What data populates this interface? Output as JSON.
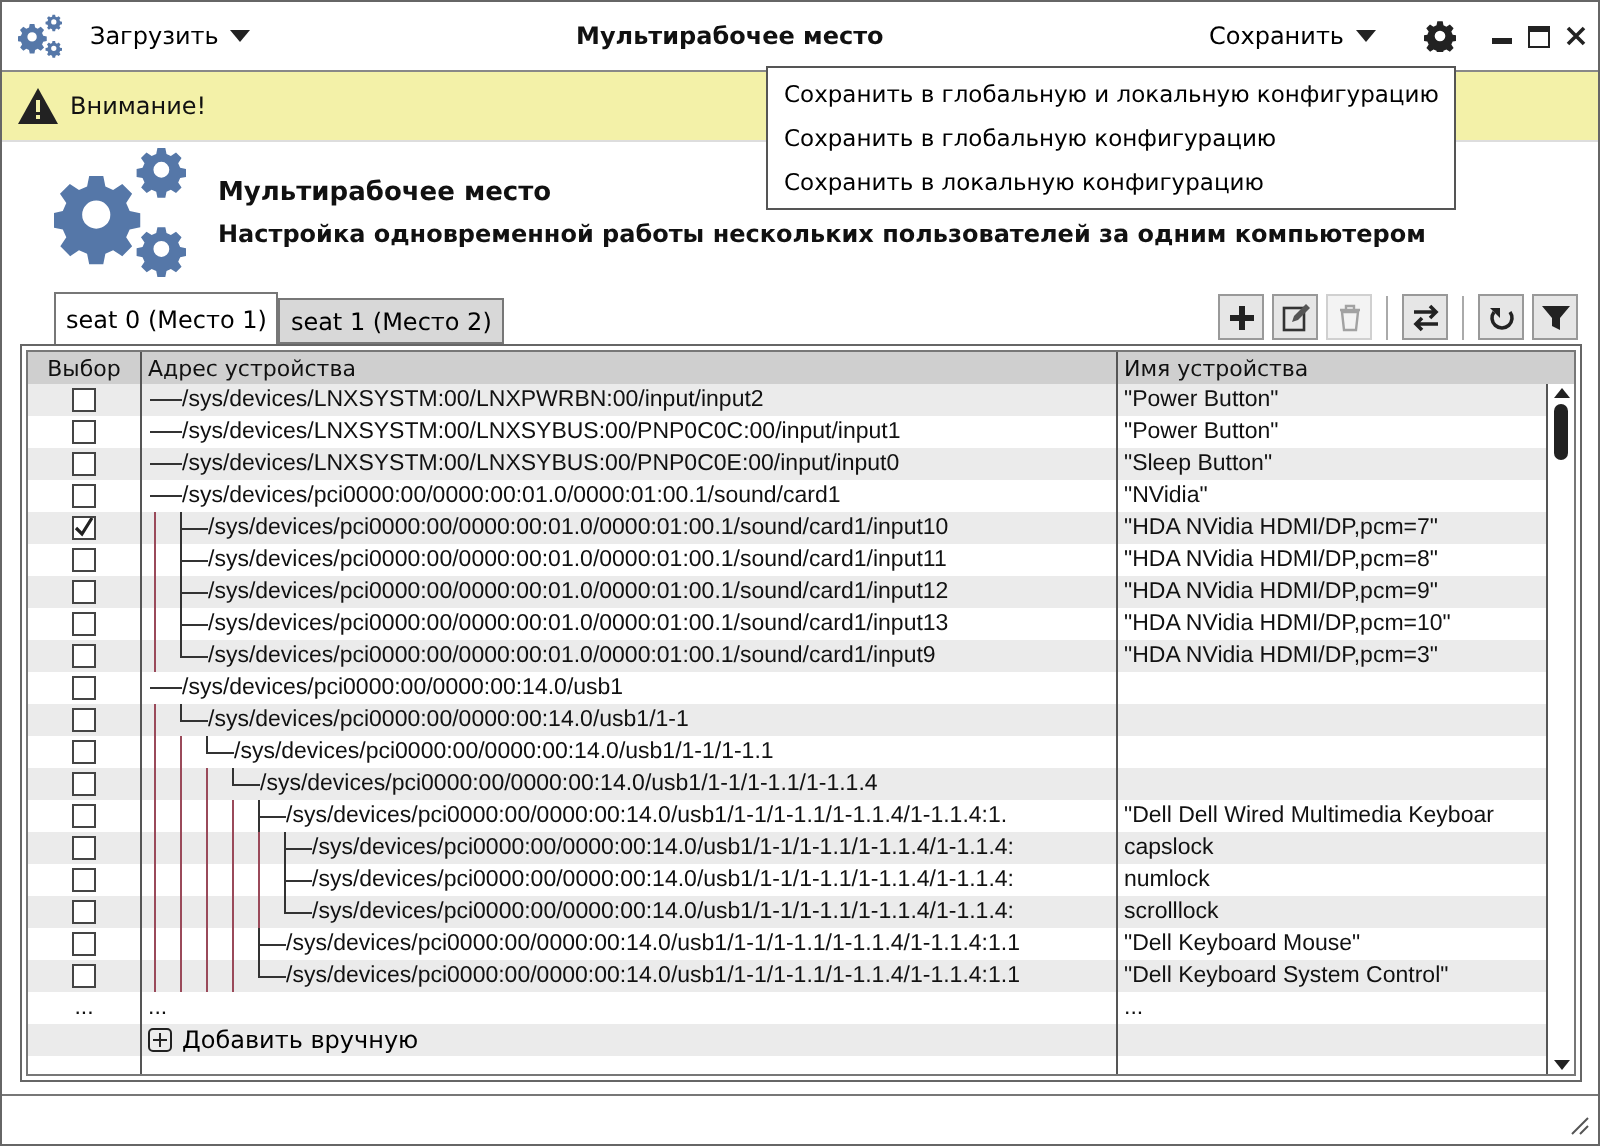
{
  "window": {
    "title": "Мультирабочее место",
    "menus": [
      {
        "label": "Загрузить"
      },
      {
        "label": "Сохранить"
      }
    ]
  },
  "save_menu": {
    "items": [
      "Сохранить в глобальную и локальную конфигурацию",
      "Сохранить в глобальную конфигурацию",
      "Сохранить в локальную конфигурацию"
    ]
  },
  "warning": {
    "text": "Внимание!"
  },
  "banner": {
    "title": "Мультирабочее место",
    "subtitle": "Настройка одновременной работы нескольких пользователей за одним компьютером"
  },
  "tabs": [
    {
      "label": "seat 0 (Место 1)",
      "selected": true
    },
    {
      "label": "seat 1 (Место 2)",
      "selected": false
    }
  ],
  "toolbar": [
    {
      "kind": "add",
      "disabled": false
    },
    {
      "kind": "edit",
      "disabled": false
    },
    {
      "kind": "delete",
      "disabled": true
    },
    {
      "kind": "swap",
      "disabled": false
    },
    {
      "kind": "refresh",
      "disabled": false
    },
    {
      "kind": "filter",
      "disabled": false
    }
  ],
  "table": {
    "columns": [
      "Выбор",
      "Адрес устройства",
      "Имя устройства"
    ],
    "rows": [
      {
        "checked": false,
        "address": "/sys/devices/LNXSYSTM:00/LNXPWRBN:00/input/input2",
        "name": "\"Power Button\""
      },
      {
        "checked": false,
        "address": "/sys/devices/LNXSYSTM:00/LNXSYBUS:00/PNP0C0C:00/input/input1",
        "name": "\"Power Button\""
      },
      {
        "checked": false,
        "address": "/sys/devices/LNXSYSTM:00/LNXSYBUS:00/PNP0C0E:00/input/input0",
        "name": "\"Sleep Button\""
      },
      {
        "checked": false,
        "address": "/sys/devices/pci0000:00/0000:00:01.0/0000:01:00.1/sound/card1",
        "name": "\"NVidia\"",
        "children": [
          {
            "checked": true,
            "address": "/sys/devices/pci0000:00/0000:00:01.0/0000:01:00.1/sound/card1/input10",
            "name": "\"HDA NVidia HDMI/DP,pcm=7\""
          },
          {
            "checked": false,
            "address": "/sys/devices/pci0000:00/0000:00:01.0/0000:01:00.1/sound/card1/input11",
            "name": "\"HDA NVidia HDMI/DP,pcm=8\""
          },
          {
            "checked": false,
            "address": "/sys/devices/pci0000:00/0000:00:01.0/0000:01:00.1/sound/card1/input12",
            "name": "\"HDA NVidia HDMI/DP,pcm=9\""
          },
          {
            "checked": false,
            "address": "/sys/devices/pci0000:00/0000:00:01.0/0000:01:00.1/sound/card1/input13",
            "name": "\"HDA NVidia HDMI/DP,pcm=10\""
          },
          {
            "checked": false,
            "address": "/sys/devices/pci0000:00/0000:00:01.0/0000:01:00.1/sound/card1/input9",
            "name": "\"HDA NVidia HDMI/DP,pcm=3\""
          }
        ]
      },
      {
        "checked": false,
        "address": "/sys/devices/pci0000:00/0000:00:14.0/usb1",
        "children": [
          {
            "checked": false,
            "address": "/sys/devices/pci0000:00/0000:00:14.0/usb1/1-1",
            "children": [
              {
                "checked": false,
                "address": "/sys/devices/pci0000:00/0000:00:14.0/usb1/1-1/1-1.1",
                "children": [
                  {
                    "checked": false,
                    "address": "/sys/devices/pci0000:00/0000:00:14.0/usb1/1-1/1-1.1/1-1.1.4",
                    "children": [
                      {
                        "checked": false,
                        "address": "/sys/devices/pci0000:00/0000:00:14.0/usb1/1-1/1-1.1/1-1.1.4/1-1.1.4:1.",
                        "name": "\"Dell Dell Wired Multimedia Keyboar",
                        "children": [
                          {
                            "checked": false,
                            "address": "/sys/devices/pci0000:00/0000:00:14.0/usb1/1-1/1-1.1/1-1.1.4/1-1.1.4:",
                            "name": "capslock"
                          },
                          {
                            "checked": false,
                            "address": "/sys/devices/pci0000:00/0000:00:14.0/usb1/1-1/1-1.1/1-1.1.4/1-1.1.4:",
                            "name": "numlock"
                          },
                          {
                            "checked": false,
                            "address": "/sys/devices/pci0000:00/0000:00:14.0/usb1/1-1/1-1.1/1-1.1.4/1-1.1.4:",
                            "name": "scrolllock"
                          }
                        ]
                      },
                      {
                        "checked": false,
                        "address": "/sys/devices/pci0000:00/0000:00:14.0/usb1/1-1/1-1.1/1-1.1.4/1-1.1.4:1.1",
                        "name": "\"Dell Keyboard Mouse\""
                      },
                      {
                        "checked": false,
                        "address": "/sys/devices/pci0000:00/0000:00:14.0/usb1/1-1/1-1.1/1-1.1.4/1-1.1.4:1.1",
                        "name": "\"Dell Keyboard System Control\""
                      }
                    ]
                  }
                ]
              }
            ]
          }
        ]
      }
    ],
    "more_row": {
      "select": "...",
      "address": "...",
      "name": "..."
    },
    "add_row": {
      "label": "Добавить вручную"
    }
  }
}
